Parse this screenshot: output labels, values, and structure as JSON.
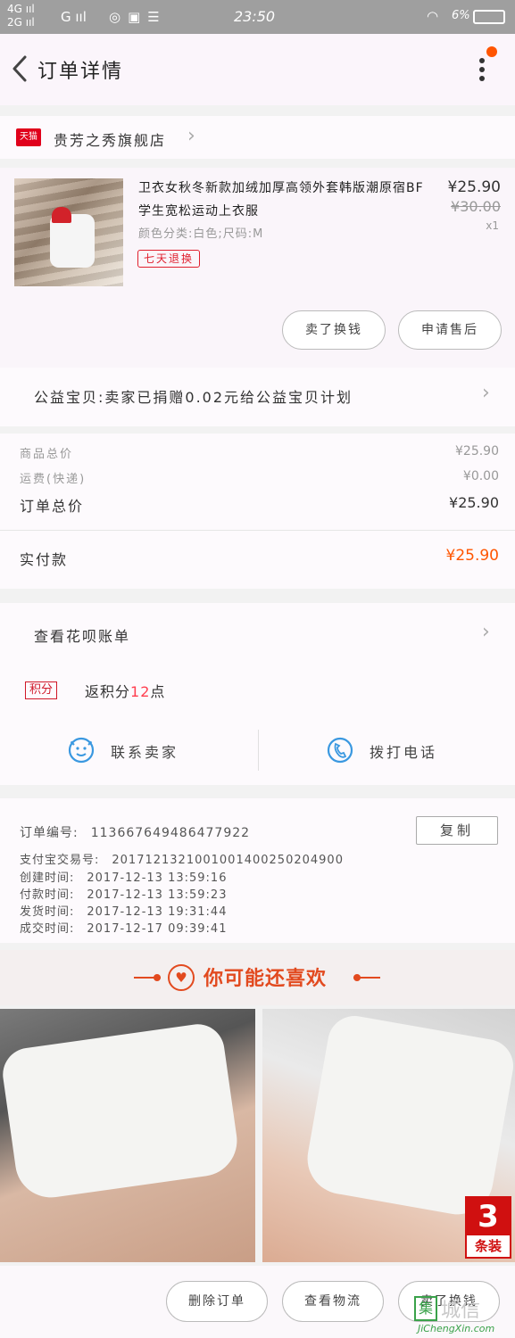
{
  "status_bar": {
    "network_1": "4G",
    "network_2": "2G",
    "signal_g": "G",
    "time": "23:50",
    "battery": "6%"
  },
  "header": {
    "title": "订单详情"
  },
  "shop": {
    "badge": "天猫",
    "name": "贵芳之秀旗舰店"
  },
  "product": {
    "title": "卫衣女秋冬新款加绒加厚高领外套韩版潮原宿BF学生宽松运动上衣服",
    "spec": "颜色分类:白色;尺码:M",
    "tag": "七天退换",
    "price": "¥25.90",
    "original_price": "¥30.00",
    "quantity": "x1",
    "btn_exchange": "卖了换钱",
    "btn_aftersale": "申请售后"
  },
  "charity": {
    "text": "公益宝贝:卖家已捐赠0.02元给公益宝贝计划"
  },
  "totals": {
    "goods_label": "商品总价",
    "goods_value": "¥25.90",
    "shipping_label": "运费(快递)",
    "shipping_value": "¥0.00",
    "order_total_label": "订单总价",
    "order_total_value": "¥25.90",
    "paid_label": "实付款",
    "paid_value": "¥25.90"
  },
  "installment": {
    "text": "查看花呗账单",
    "points_badge": "积分",
    "points_prefix": "返积分",
    "points_num": "12",
    "points_suffix": "点",
    "contact_seller": "联系卖家",
    "call_phone": "拨打电话"
  },
  "order_info": {
    "order_no_label": "订单编号:",
    "order_no": "113667649486477922",
    "copy_label": "复制",
    "alipay_label": "支付宝交易号:",
    "alipay_no": "2017121321001001400250204900",
    "created_label": "创建时间:",
    "created": "2017-12-13 13:59:16",
    "paid_label": "付款时间:",
    "paid": "2017-12-13 13:59:23",
    "shipped_label": "发货时间:",
    "shipped": "2017-12-13 19:31:44",
    "completed_label": "成交时间:",
    "completed": "2017-12-17 09:39:41"
  },
  "recommend": {
    "title": "你可能还喜欢",
    "badge_num": "3",
    "badge_text": "条装"
  },
  "bottom_bar": {
    "delete": "删除订单",
    "logistics": "查看物流",
    "exchange": "卖了换钱"
  },
  "watermark": {
    "cn": "城信",
    "en": "JiChengXin.com",
    "logo": "集"
  },
  "colors": {
    "accent": "#ff5500",
    "tmall_red": "#e0001b",
    "contact_blue": "#3a98e0"
  }
}
